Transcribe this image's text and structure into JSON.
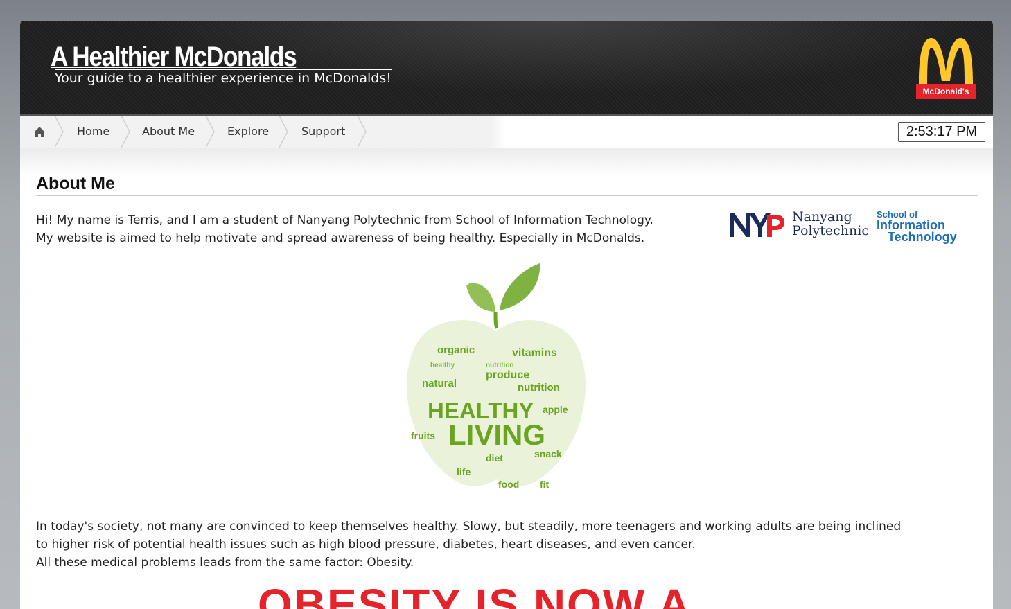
{
  "header": {
    "title": "A Healthier McDonalds",
    "subtitle": "Your guide to a healthier experience in McDonalds!",
    "logo_text": "McDonald's"
  },
  "nav": {
    "home_icon": "home-icon",
    "items": [
      "Home",
      "About Me",
      "Explore",
      "Support"
    ],
    "clock": "2:53:17 PM"
  },
  "main": {
    "title": "About Me",
    "intro_line1": "Hi! My name is Terris, and I am a student of Nanyang Polytechnic from School of Information Technology.",
    "intro_line2": "My website is aimed to help motivate and spread awareness of being healthy. Especially in McDonalds.",
    "nyp_logo": {
      "mark": "NYP",
      "name_line1": "Nanyang",
      "name_line2": "Polytechnic",
      "school_line1": "School of",
      "school_line2": "Information",
      "school_line3": "Technology"
    },
    "apple_image": {
      "headline1": "HEALTHY",
      "headline2": "LIVING",
      "words": [
        "food",
        "organic",
        "vitamins",
        "healthy",
        "nutrition",
        "produce",
        "natural",
        "apple",
        "snack",
        "fruits",
        "diet",
        "life",
        "fit"
      ]
    },
    "body_line1": "In today's society, not many are convinced to keep themselves healthy. Slowy, but steadily, more teenagers and working adults are being inclined",
    "body_line2": "to higher risk of potential health issues such as high blood pressure, diabetes, heart diseases, and even cancer.",
    "body_line3": "All these medical problems leads from the same factor: Obesity.",
    "obesity_banner": "OBESITY IS NOW A"
  },
  "colors": {
    "accent_red": "#e4232b",
    "mcd_yellow": "#ffc72c",
    "apple_green": "#6aa421",
    "nyp_blue": "#1b2a5a",
    "sit_blue": "#1f6fb8"
  }
}
